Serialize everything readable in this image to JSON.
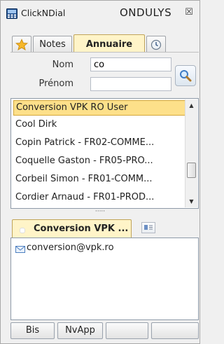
{
  "window": {
    "app_title": "ClickNDial",
    "brand": "ONDULYS",
    "close_glyph": "☒"
  },
  "tabs": [
    {
      "id": "favorites",
      "label": "",
      "icon": "star-icon"
    },
    {
      "id": "notes",
      "label": "Notes"
    },
    {
      "id": "annuaire",
      "label": "Annuaire",
      "active": true
    },
    {
      "id": "history",
      "label": "",
      "icon": "history-icon"
    }
  ],
  "search": {
    "nom_label": "Nom",
    "nom_value": "co",
    "prenom_label": "Prénom",
    "prenom_value": "",
    "button_icon": "search-icon"
  },
  "results": [
    {
      "text": "Conversion VPK RO User",
      "selected": true
    },
    {
      "text": "Cool  Dirk"
    },
    {
      "text": "Copin Patrick - FR02-COMME..."
    },
    {
      "text": "Coquelle Gaston - FR05-PRO..."
    },
    {
      "text": "Corbeil Simon - FR01-COMM..."
    },
    {
      "text": "Cordier Arnaud - FR01-PROD..."
    }
  ],
  "splitter_glyph": "·····",
  "detail": {
    "tab_label": "Conversion VPK ...",
    "email": "conversion@vpk.ro"
  },
  "buttons": {
    "bis": "Bis",
    "nvapp": "NvApp",
    "btn3": "",
    "btn4": ""
  },
  "colors": {
    "accent": "#fde08a",
    "accent_border": "#d3a73a",
    "tab_active": "#fff4c8"
  }
}
